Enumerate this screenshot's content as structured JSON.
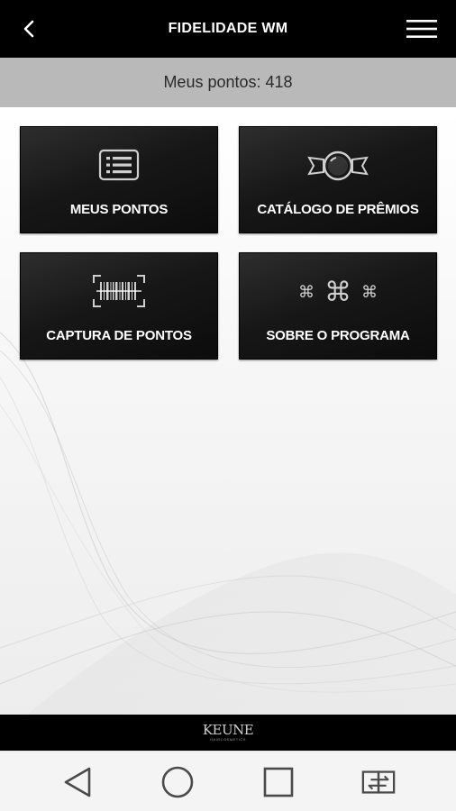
{
  "header": {
    "title": "FIDELIDADE WM",
    "back_icon": "chevron-left-icon",
    "menu_icon": "hamburger-menu-icon"
  },
  "points_bar": {
    "text": "Meus pontos: 418"
  },
  "tiles": [
    {
      "label": "MEUS PONTOS",
      "icon": "list-icon"
    },
    {
      "label": "CATÁLOGO DE PRÊMIOS",
      "icon": "prize-ribbon-icon"
    },
    {
      "label": "CAPTURA DE PONTOS",
      "icon": "barcode-scan-icon"
    },
    {
      "label": "SOBRE O PROGRAMA",
      "icon": "command-icon"
    }
  ],
  "footer": {
    "logo_text": "KEUNE",
    "logo_subtext": "HAIRCOSMETICS"
  },
  "system_nav": {
    "buttons": [
      "back-triangle-icon",
      "home-circle-icon",
      "recents-square-icon",
      "switch-app-icon"
    ]
  },
  "colors": {
    "header_bg": "#000000",
    "points_bar_bg": "#b9b9b9",
    "tile_bg": "#1a1a1a",
    "tile_text": "#ffffff"
  }
}
